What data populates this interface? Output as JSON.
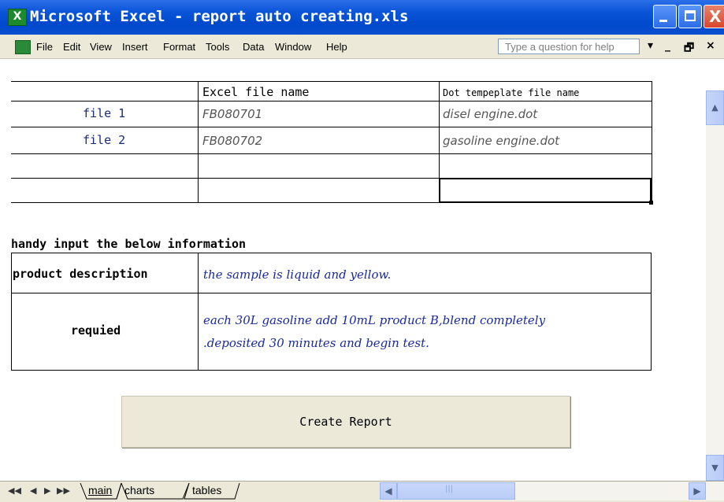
{
  "window": {
    "app_icon_letter": "X",
    "title": "Microsoft Excel - report auto creating.xls",
    "controls": {
      "close_glyph": "X"
    }
  },
  "menu": {
    "items": [
      "File",
      "Edit",
      "View",
      "Insert",
      "Format",
      "Tools",
      "Data",
      "Window",
      "Help"
    ],
    "help_placeholder": "Type a question for help",
    "dropdown_glyph": "▾",
    "restore_glyph": "_ ",
    "mdi_restore_glyph": "🗗",
    "mdi_close_glyph": "×"
  },
  "sheet": {
    "file_table": {
      "headers": [
        "Excel file name",
        "Dot tempeplate file name"
      ],
      "rows": [
        {
          "label": "file 1",
          "excel_file": "FB080701",
          "dot_template": "disel engine.dot"
        },
        {
          "label": "file 2",
          "excel_file": "FB080702",
          "dot_template": "gasoline engine.dot"
        }
      ]
    },
    "section_title": "handy input the below information",
    "info_table": {
      "product_description_label": "product description",
      "product_description_value": "the sample is liquid and yellow.",
      "required_label": "requied",
      "required_value_line1": "each 30L gasoline add 10mL product B,blend completely",
      "required_value_line2": ".deposited 30 minutes and begin test."
    },
    "create_report_label": "Create Report"
  },
  "tabs": {
    "nav_glyphs": [
      "◀◀",
      "◀",
      "▶",
      "▶▶"
    ],
    "sheets": [
      "main",
      "charts",
      "tables"
    ],
    "active": "main"
  },
  "scroll": {
    "up_glyph": "▲",
    "down_glyph": "▼",
    "left_glyph": "◀",
    "right_glyph": "▶"
  }
}
